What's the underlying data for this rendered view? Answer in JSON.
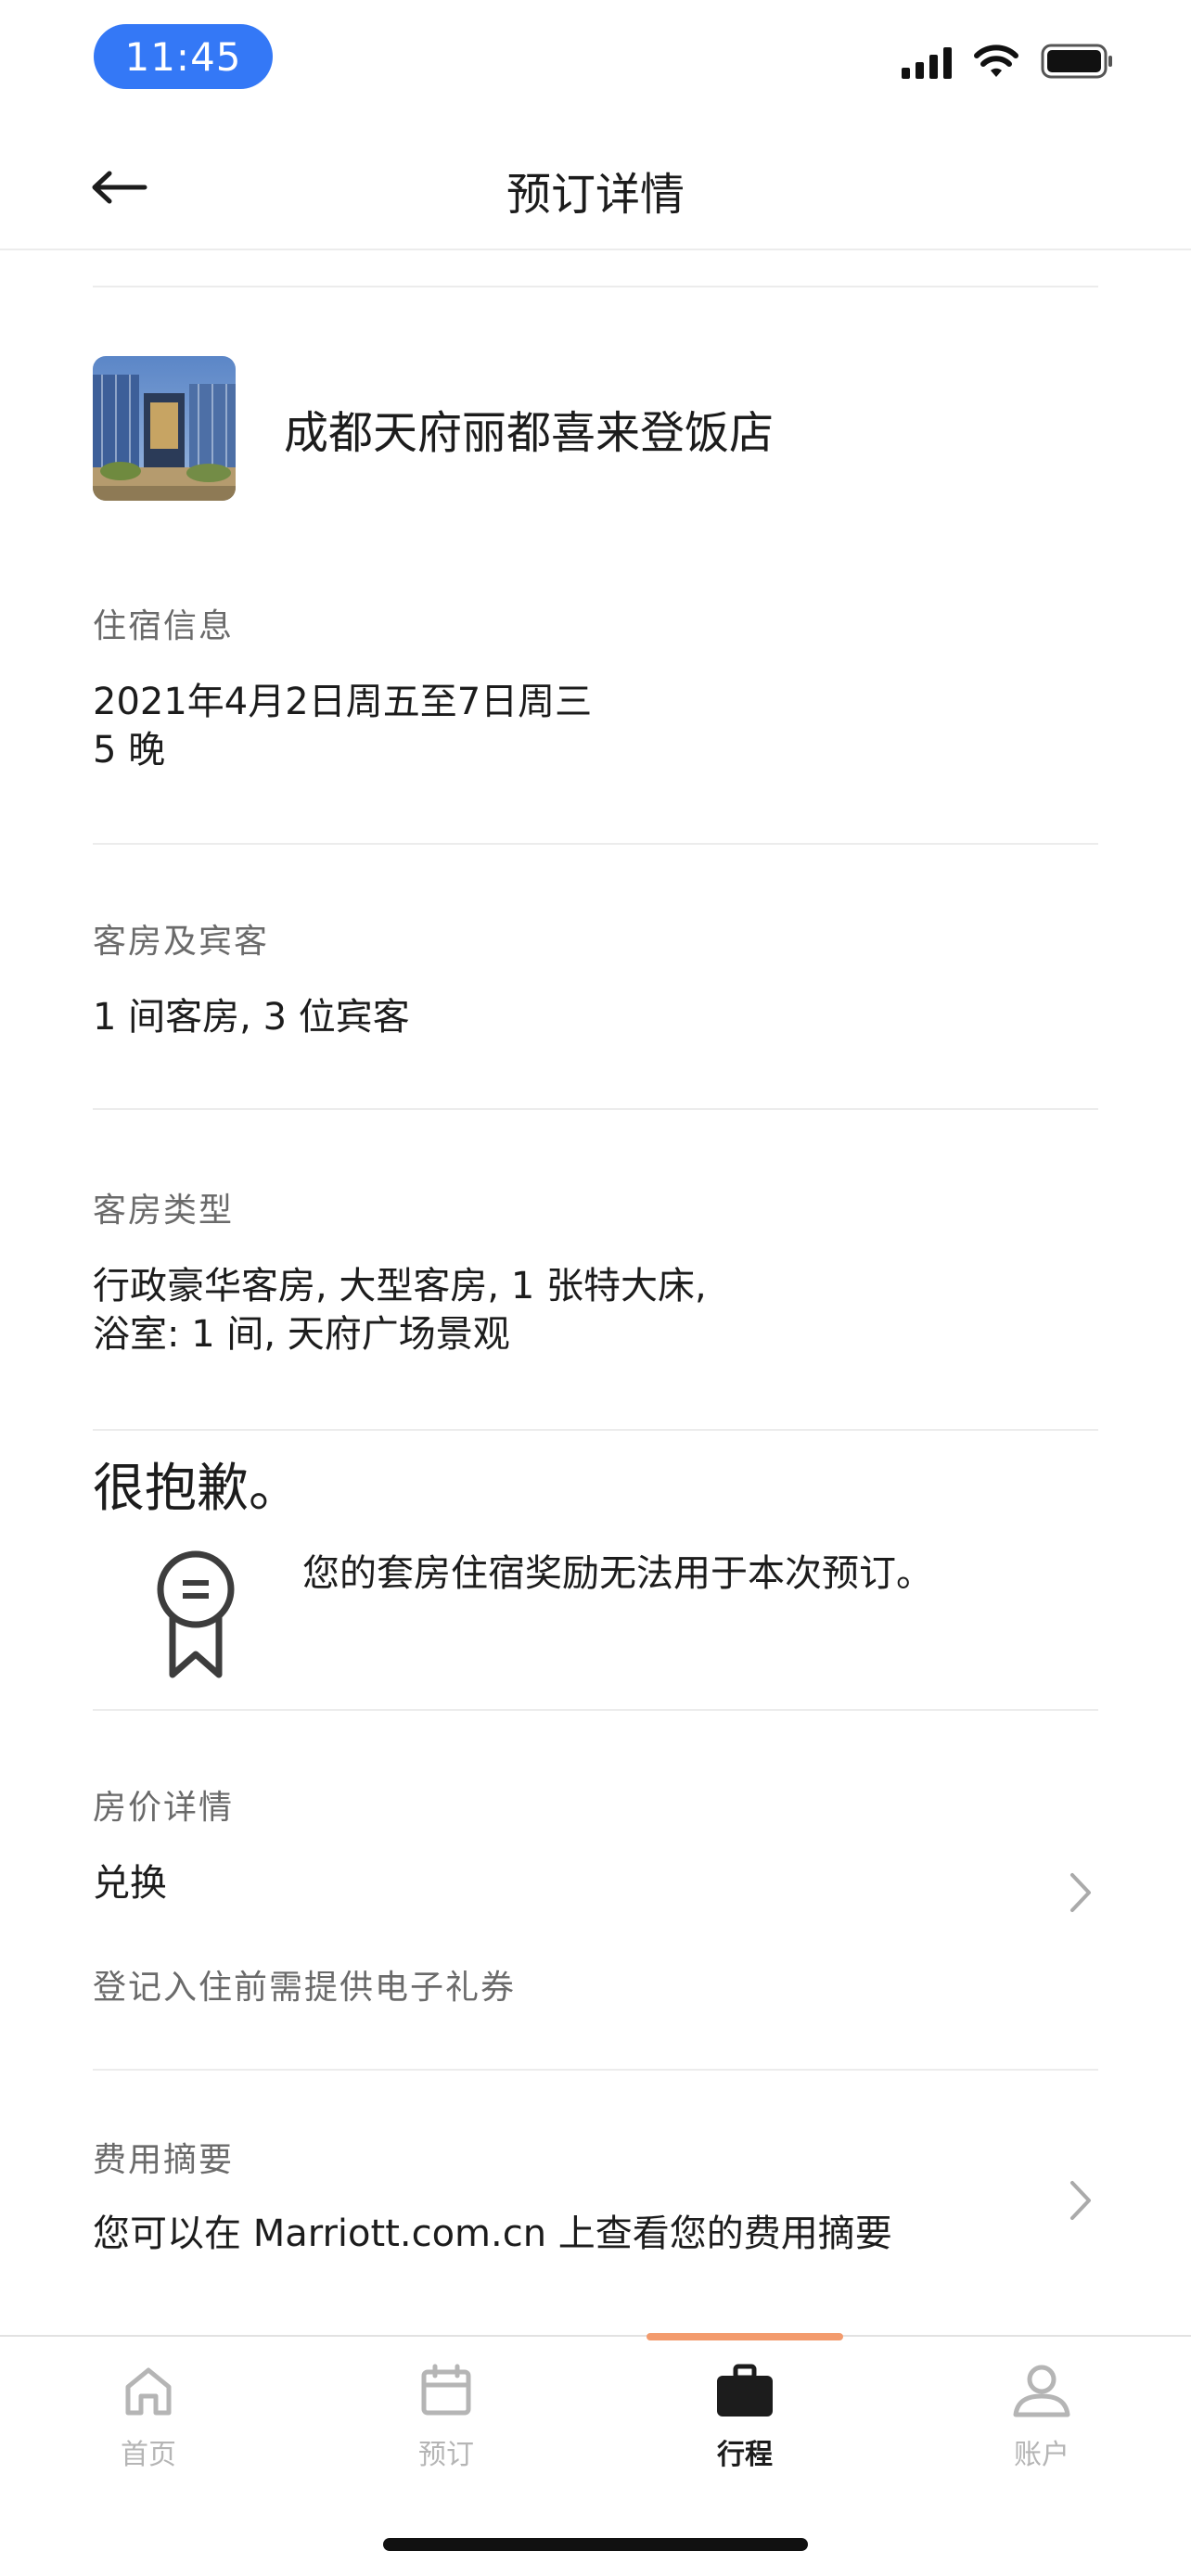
{
  "status_bar": {
    "time": "11:45"
  },
  "header": {
    "title": "预订详情"
  },
  "hotel": {
    "name": "成都天府丽都喜来登饭店"
  },
  "stay": {
    "label": "住宿信息",
    "dates": "2021年4月2日周五至7日周三",
    "nights": "5 晚"
  },
  "rooms_guests": {
    "label": "客房及宾客",
    "value": "1 间客房, 3 位宾客"
  },
  "room_type": {
    "label": "客房类型",
    "line1": "行政豪华客房, 大型客房, 1  张特大床,",
    "line2": "浴室: 1 间, 天府广场景观"
  },
  "notice": {
    "title": "很抱歉。",
    "message": "您的套房住宿奖励无法用于本次预订。"
  },
  "rate": {
    "label": "房价详情",
    "value": "兑换",
    "note": "登记入住前需提供电子礼券"
  },
  "charges": {
    "label": "费用摘要",
    "value": "您可以在 Marriott.com.cn 上查看您的费用摘要"
  },
  "tabs": [
    {
      "label": "首页",
      "icon": "home-icon"
    },
    {
      "label": "预订",
      "icon": "calendar-icon"
    },
    {
      "label": "行程",
      "icon": "briefcase-icon"
    },
    {
      "label": "账户",
      "icon": "account-icon"
    }
  ],
  "colors": {
    "time_pill": "#3478f6",
    "active_indicator": "#f39b6d",
    "inactive_tab": "#b5b5b5"
  }
}
